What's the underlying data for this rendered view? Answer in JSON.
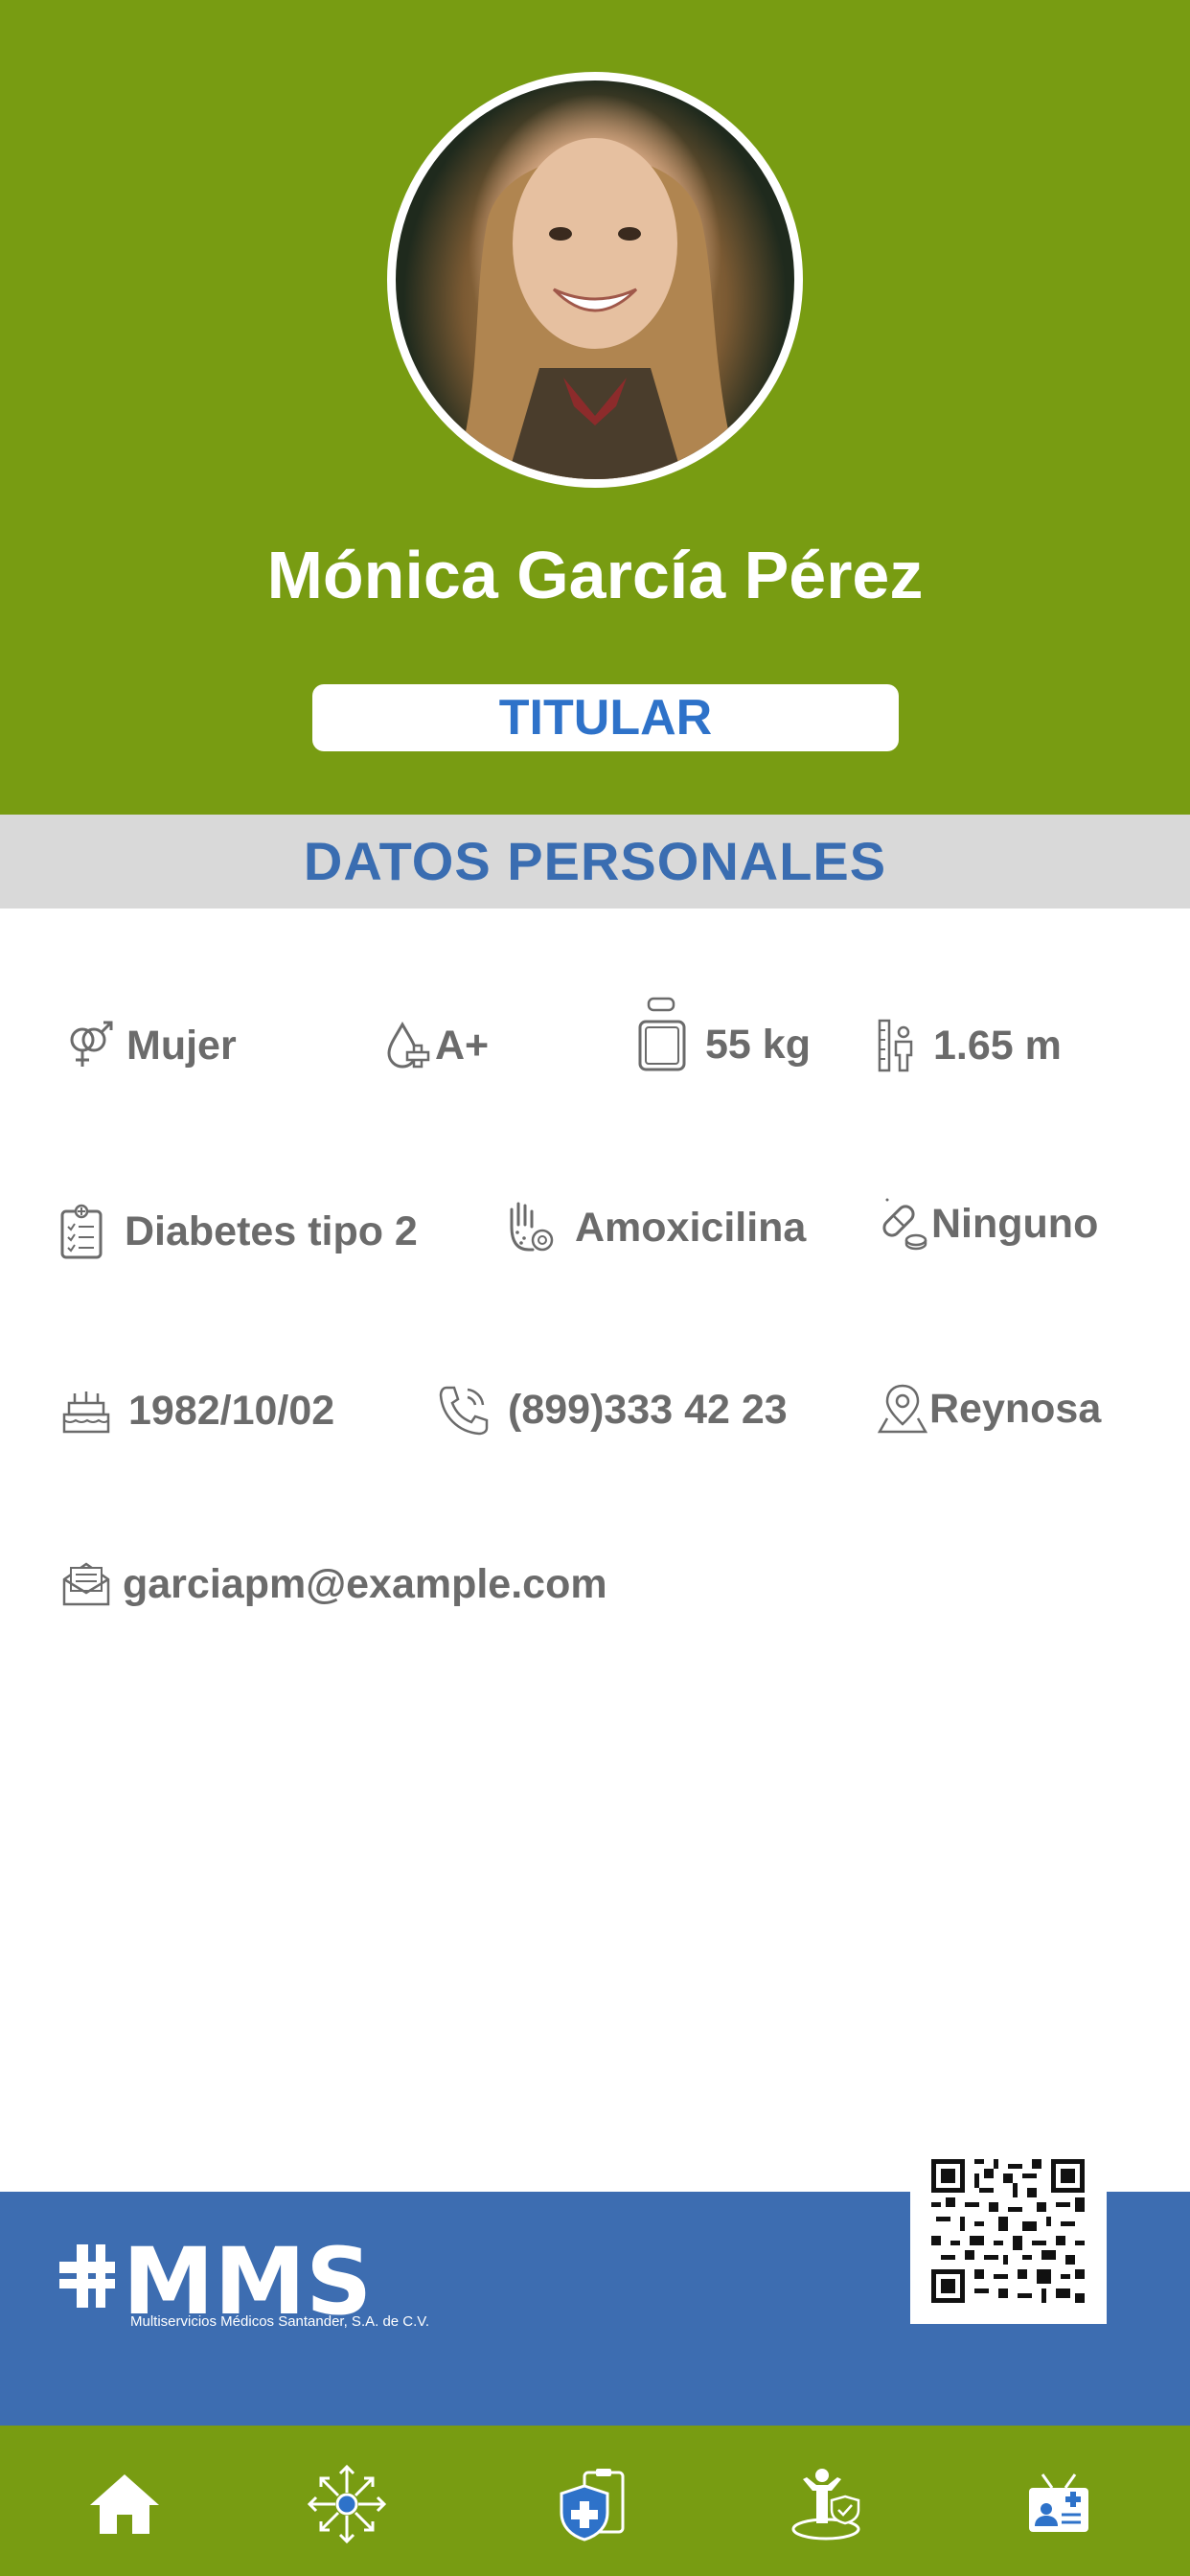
{
  "profile": {
    "name": "Mónica García Pérez",
    "role_badge": "TITULAR",
    "photo_alt": "avatar"
  },
  "section": {
    "title": "DATOS PERSONALES"
  },
  "personal": {
    "gender": "Mujer",
    "blood_type": "A+",
    "weight": "55 kg",
    "height": "1.65 m",
    "condition": "Diabetes tipo 2",
    "allergy": "Amoxicilina",
    "medication": "Ninguno",
    "birthdate": "1982/10/02",
    "phone": "(899)333 42 23",
    "city": "Reynosa",
    "email": "garciapm@example.com"
  },
  "brand": {
    "logo_text": "MMS",
    "logo_subtitle": "Multiservicios Médicos Santander, S.A. de C.V."
  },
  "icons": {
    "gender": "gender-icon",
    "blood": "blood-drop-icon",
    "weight": "scale-icon",
    "height": "height-icon",
    "condition": "clipboard-icon",
    "allergy": "allergy-hand-icon",
    "medication": "pill-icon",
    "birthdate": "cake-icon",
    "phone": "phone-icon",
    "city": "location-icon",
    "email": "email-icon"
  },
  "nav": {
    "items": [
      "home-icon",
      "network-icon",
      "medical-shield-icon",
      "person-shield-icon",
      "id-card-icon"
    ]
  },
  "colors": {
    "primary_green": "#789c12",
    "brand_blue": "#3d6db1",
    "badge_text": "#2e72c9",
    "section_bg": "#d9d9d9",
    "text_gray": "#6b6b6b"
  }
}
